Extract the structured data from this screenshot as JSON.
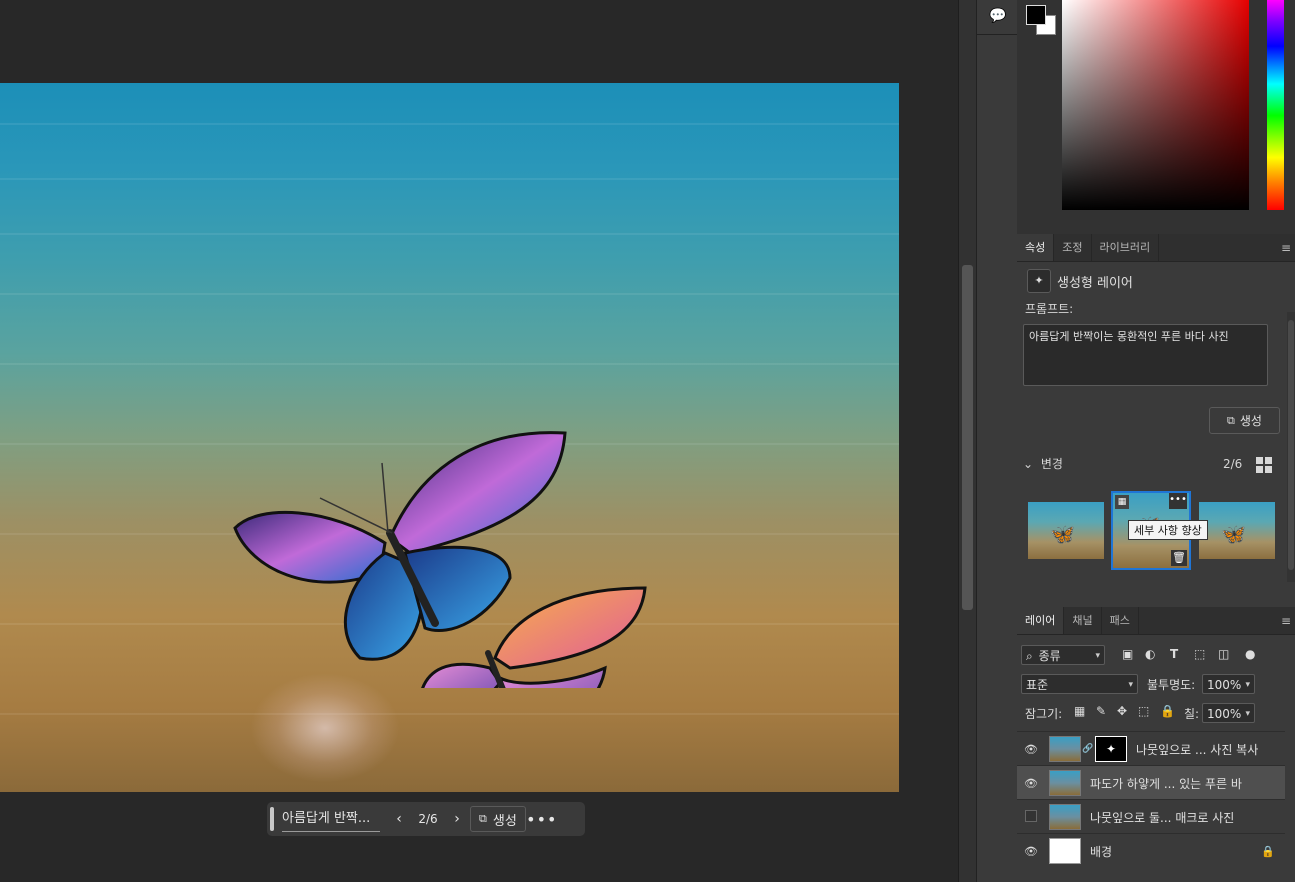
{
  "canvas": {
    "description_colors": {
      "water_top": "#1c8fb8",
      "sand_bottom": "#8b6a3a"
    }
  },
  "taskbar": {
    "prompt": "아름답게 반짝...",
    "prev_icon": "chevron-left-icon",
    "counter": "2/6",
    "next_icon": "chevron-right-icon",
    "generate_label": "생성",
    "more_icon": "more-icon"
  },
  "properties_panel": {
    "tabs": [
      "속성",
      "조정",
      "라이브러리"
    ],
    "layer_type": "생성형 레이어",
    "prompt_label": "프롬프트:",
    "prompt_text": "아름답게 반짝이는 몽환적인 푸른 바다 사진",
    "generate_label": "생성",
    "variations_label": "변경",
    "variations_count": "2/6",
    "tooltip": "세부 사항 향상"
  },
  "layers_panel": {
    "tabs": [
      "레이어",
      "채널",
      "패스"
    ],
    "filter_kind": "종류",
    "blend_mode": "표준",
    "opacity_label": "불투명도:",
    "opacity_value": "100%",
    "lock_label": "잠그기:",
    "fill_label": "칠:",
    "fill_value": "100%",
    "layers": [
      {
        "name": "나뭇잎으로 ... 사진 복사",
        "visible": true,
        "selected": false
      },
      {
        "name": "파도가 하얗게 ... 있는 푸른 바",
        "visible": true,
        "selected": true
      },
      {
        "name": "나뭇잎으로 둘... 매크로 사진",
        "visible": false,
        "selected": false
      },
      {
        "name": "배경",
        "visible": true,
        "selected": false,
        "locked": true
      }
    ]
  },
  "colors": {
    "foreground": "#000000",
    "background": "#ffffff",
    "selection_accent": "#1f75d6"
  }
}
